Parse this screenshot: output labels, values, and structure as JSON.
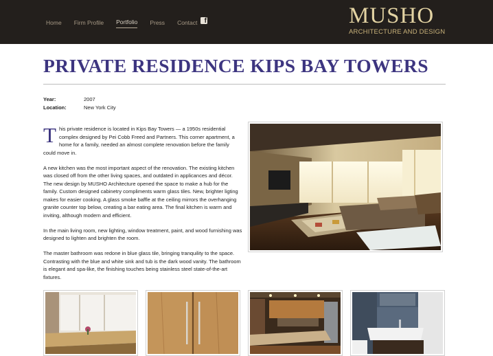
{
  "header": {
    "nav": [
      {
        "label": "Home"
      },
      {
        "label": "Firm Profile"
      },
      {
        "label": "Portfolio",
        "active": true
      },
      {
        "label": "Press"
      },
      {
        "label": "Contact"
      }
    ],
    "social_icon": "facebook-icon",
    "logo": {
      "name": "MUSHO",
      "tagline": "ARCHITECTURE AND DESIGN"
    }
  },
  "page": {
    "title": "PRIVATE RESIDENCE KIPS BAY TOWERS",
    "meta": {
      "year_label": "Year:",
      "year_value": "2007",
      "location_label": "Location:",
      "location_value": "New York City"
    },
    "body": {
      "dropcap": "T",
      "p1": "his private residence is located in Kips Bay Towers — a 1950s residential complex designed by Pei Cobb Freed and Partners. This corner apartment, a home for a family, needed an almost complete renovation before the family could move in.",
      "p2": "A new kitchen was the most important aspect of the renovation. The existing kitchen was closed off from the other living spaces, and outdated in applicances and décor. The new design by MUSHO Architecture opened the space to make a hub for the family. Custom designed cabinetry compliments warm glass tiles. New, brighter ligting makes for easier cooking. A glass smoke baffle at the ceiling mirrors the overhanging granite counter top below, creating a bar eating area. The final kitchen is warm and inviting, although modern and efficient.",
      "p3": "In the main living room, new lighting, window treatment, paint, and wood furnishing was designed to lighten and brighten the room.",
      "p4": "The master bathroom was redone in blue glass tile, bringing tranquility to the space. Contrasting with the blue and white sink and tub is the dark wood vanity. The bathroom is elegant and spa-like, the finishing touches being stainless steel state-of-the-art fixtures."
    }
  },
  "colors": {
    "header_bg": "#231f1c",
    "title": "#3d3580",
    "logo": "#e3d3a3"
  }
}
